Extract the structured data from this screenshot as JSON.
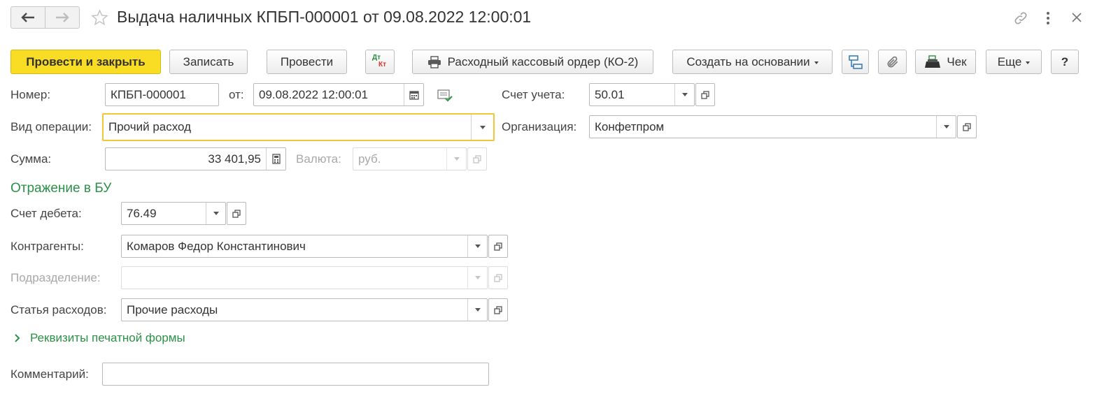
{
  "header": {
    "title": "Выдача наличных КПБП-000001 от 09.08.2022 12:00:01"
  },
  "toolbar": {
    "post_close": "Провести и закрыть",
    "write": "Записать",
    "post": "Провести",
    "dtkt_top": "Дт",
    "dtkt_bottom": "Кт",
    "print_ko2": "Расходный кассовый ордер (КО-2)",
    "create_based": "Создать на основании",
    "check": "Чек",
    "more": "Еще",
    "help": "?"
  },
  "form": {
    "number_label": "Номер:",
    "number_value": "КПБП-000001",
    "date_label": "от:",
    "date_value": "09.08.2022 12:00:01",
    "account_label": "Счет учета:",
    "account_value": "50.01",
    "operation_label": "Вид операции:",
    "operation_value": "Прочий расход",
    "org_label": "Организация:",
    "org_value": "Конфетпром",
    "sum_label": "Сумма:",
    "sum_value": "33 401,95",
    "currency_label": "Валюта:",
    "currency_value": "руб."
  },
  "bu": {
    "section_title": "Отражение в БУ",
    "debit_label": "Счет дебета:",
    "debit_value": "76.49",
    "contractors_label": "Контрагенты:",
    "contractors_value": "Комаров Федор Константинович",
    "division_label": "Подразделение:",
    "division_value": "",
    "expense_label": "Статья расходов:",
    "expense_value": "Прочие расходы"
  },
  "print_requisites": "Реквизиты печатной формы",
  "comment": {
    "label": "Комментарий:",
    "value": ""
  },
  "colors": {
    "accent_yellow": "#f9dc24",
    "section_green": "#2a9146",
    "focus_border": "#f0c63a"
  }
}
